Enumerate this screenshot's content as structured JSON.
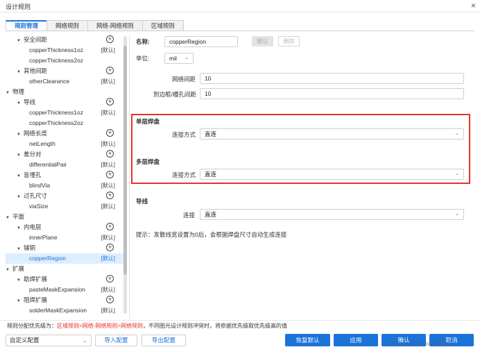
{
  "window": {
    "title": "设计规则",
    "close_glyph": "×"
  },
  "tabs": [
    "规则管理",
    "网络规则",
    "网络-网络规则",
    "区域规则"
  ],
  "tree": {
    "default_tag": "[默认]",
    "nodes": [
      {
        "label": "安全间距",
        "arrow": "▼",
        "add": true
      },
      {
        "label": "copperThickness1oz",
        "tag": "[默认]"
      },
      {
        "label": "copperThickness2oz"
      },
      {
        "label": "其他间距",
        "arrow": "▼",
        "add": true
      },
      {
        "label": "otherClearance",
        "tag": "[默认]"
      },
      {
        "label": "物理",
        "arrow": "▼"
      },
      {
        "label": "导线",
        "arrow": "▼",
        "add": true
      },
      {
        "label": "copperThickness1oz",
        "tag": "[默认]"
      },
      {
        "label": "copperThickness2oz"
      },
      {
        "label": "网络长度",
        "arrow": "▼",
        "add": true
      },
      {
        "label": "netLength",
        "tag": "[默认]"
      },
      {
        "label": "差分对",
        "arrow": "▼",
        "add": true
      },
      {
        "label": "differentialPair",
        "tag": "[默认]"
      },
      {
        "label": "盲埋孔",
        "arrow": "▼",
        "add": true
      },
      {
        "label": "blindVia",
        "tag": "[默认]"
      },
      {
        "label": "过孔尺寸",
        "arrow": "▼",
        "add": true
      },
      {
        "label": "viaSize",
        "tag": "[默认]"
      },
      {
        "label": "平面",
        "arrow": "▼"
      },
      {
        "label": "内电层",
        "arrow": "▼",
        "add": true
      },
      {
        "label": "innerPlane",
        "tag": "[默认]"
      },
      {
        "label": "铺铜",
        "arrow": "▼",
        "add": true
      },
      {
        "label": "copperRegion",
        "tag": "[默认]",
        "selected": true
      },
      {
        "label": "扩展",
        "arrow": "▼"
      },
      {
        "label": "助焊扩展",
        "arrow": "▼",
        "add": true
      },
      {
        "label": "pasteMaskExpansion",
        "tag": "[默认]"
      },
      {
        "label": "阻焊扩展",
        "arrow": "▼",
        "add": true
      },
      {
        "label": "solderMaskExpansion",
        "tag": "[默认]"
      }
    ]
  },
  "form": {
    "name_label": "名称:",
    "name_value": "copperRegion",
    "default_btn": "默认",
    "delete_btn": "删除",
    "unit_label": "单位:",
    "unit_value": "mil",
    "net_spacing_label": "网络间距",
    "net_spacing_value": "10",
    "board_spacing_label": "到边框/槽孔间距",
    "board_spacing_value": "10",
    "single_pad_heading": "单层焊盘",
    "single_conn_label": "连接方式",
    "single_conn_value": "直连",
    "multi_pad_heading": "多层焊盘",
    "multi_conn_label": "连接方式",
    "multi_conn_value": "直连",
    "track_heading": "导线",
    "track_conn_label": "连接",
    "track_conn_value": "直连",
    "hint": "提示：发散线宽设置为0后，会根据焊盘尺寸自动生成连接"
  },
  "priority": {
    "prefix": "规则分配优先级为：",
    "highlight": "区域规则>网络-网络规则>网络规则",
    "suffix": "，不同图元设计规则冲突时，将依据优先级取优先级高的值"
  },
  "footer": {
    "config_value": "自定义配置",
    "import_btn": "导入配置",
    "export_btn": "导出配置",
    "restore_btn": "恢复默认",
    "apply_btn": "应用",
    "ok_btn": "确认",
    "cancel_btn": "取消"
  },
  "watermark": "CSDN @Zevalin爱灰灰",
  "colors": {
    "accent": "#1a73d9",
    "highlight_box": "#e8302a"
  }
}
